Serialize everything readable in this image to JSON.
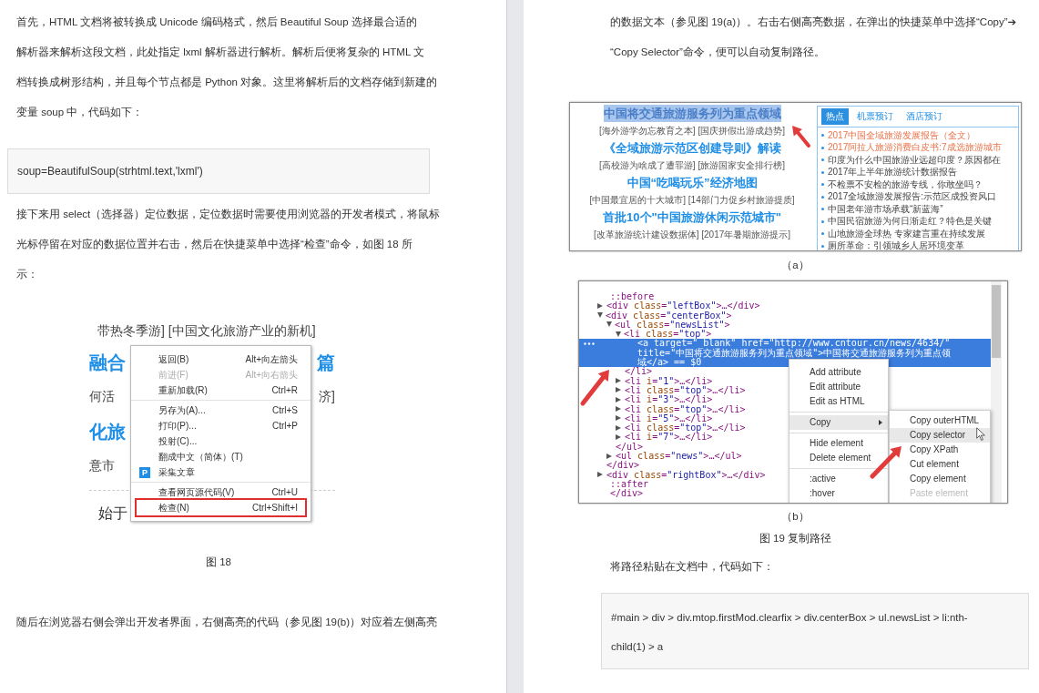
{
  "left_page": {
    "paragraph_1": [
      "首先，HTML 文档将被转换成 Unicode 编码格式，然后 Beautiful Soup 选择最合适的",
      "解析器来解析这段文档，此处指定 lxml 解析器进行解析。解析后便将复杂的 HTML 文",
      "档转换成树形结构，并且每个节点都是 Python 对象。这里将解析后的文档存储到新建的",
      "变量 soup 中，代码如下："
    ],
    "code": [
      "soup=BeautifulSoup(strhtml.text,'lxml')"
    ],
    "paragraph_2": [
      "接下来用 select（选择器）定位数据，定位数据时需要使用浏览器的开发者模式，将鼠标",
      "光标停留在对应的数据位置并右击，然后在快捷菜单中选择“检查”命令，如图 18 所",
      "示："
    ],
    "figure_18": {
      "background_rows": [
        {
          "kind": "line",
          "left": "带热冬季游] [中国文化旅游产业的新机]",
          "right": ""
        },
        {
          "kind": "headline",
          "left": "融合",
          "right": "篇"
        },
        {
          "kind": "line",
          "left": "何活",
          "right": "济]"
        },
        {
          "kind": "headline",
          "left": "化旅",
          "right": ""
        },
        {
          "kind": "line",
          "left": "意市",
          "right": ""
        },
        {
          "kind": "rule",
          "left": "",
          "right": ""
        },
        {
          "kind": "lead",
          "left": "始于",
          "right": ""
        }
      ],
      "menu": [
        [
          {
            "label": "返回(B)",
            "shortcut": "Alt+向左箭头",
            "disabled": false,
            "highlighted": false
          },
          {
            "label": "前进(F)",
            "shortcut": "Alt+向右箭头",
            "disabled": true,
            "highlighted": false
          },
          {
            "label": "重新加载(R)",
            "shortcut": "Ctrl+R",
            "disabled": false,
            "highlighted": false
          }
        ],
        [
          {
            "label": "另存为(A)...",
            "shortcut": "Ctrl+S",
            "disabled": false,
            "highlighted": false
          },
          {
            "label": "打印(P)...",
            "shortcut": "Ctrl+P",
            "disabled": false,
            "highlighted": false
          },
          {
            "label": "投射(C)...",
            "disabled": false,
            "highlighted": false
          },
          {
            "label": "翻成中文（简体）(T)",
            "disabled": false,
            "highlighted": false
          },
          {
            "label": "采集文章",
            "badge": "P",
            "disabled": false,
            "highlighted": false
          }
        ],
        [
          {
            "label": "查看网页源代码(V)",
            "shortcut": "Ctrl+U",
            "disabled": false,
            "highlighted": false
          },
          {
            "label": "检查(N)",
            "shortcut": "Ctrl+Shift+I",
            "disabled": false,
            "highlighted": true
          }
        ]
      ]
    },
    "caption": "图 18",
    "paragraph_3": [
      "随后在浏览器右侧会弹出开发者界面，右侧高亮的代码（参见图 19(b)）对应着左侧高亮"
    ]
  },
  "right_page": {
    "paragraph_1": [
      "的数据文本（参见图 19(a)）。右击右侧高亮数据，在弹出的快捷菜单中选择“Copy”➔",
      "“Copy Selector”命令，便可以自动复制路径。"
    ],
    "figure_a": {
      "headlines": [
        {
          "title": "中国将交通旅游服务列为重点领域",
          "selected": true,
          "links": "[海外游学勿忘教育之本] [国庆拼假出游成趋势]"
        },
        {
          "title": "《全域旅游示范区创建导则》解读",
          "selected": false,
          "links": "[高校游为啥成了遭罪游] [旅游国家安全排行榜]"
        },
        {
          "title": "中国“吃喝玩乐”经济地图",
          "selected": false,
          "links": "[中国最宜居的十大城市] [14部门力促乡村旅游提质]"
        },
        {
          "title": "首批10个\"中国旅游休闲示范城市\"",
          "selected": false,
          "links": "[改革旅游统计建设数据体] [2017年暑期旅游提示]"
        }
      ],
      "tabs": [
        {
          "label": "热点",
          "selected": true
        },
        {
          "label": "机票预订",
          "selected": false
        },
        {
          "label": "酒店预订",
          "selected": false
        }
      ],
      "news": [
        {
          "text": "2017中国全域旅游发展报告（全文）",
          "highlighted": true
        },
        {
          "text": "2017阿拉人旅游消费白皮书:7成选旅游城市",
          "highlighted": true
        },
        {
          "text": "印度为什么中国旅游业远超印度？原因都在",
          "highlighted": false
        },
        {
          "text": "2017年上半年旅游统计数据报告",
          "highlighted": false
        },
        {
          "text": "不检票不安检的旅游专线，你敢坐吗？",
          "highlighted": false
        },
        {
          "text": "2017全域旅游发展报告:示范区成投资风口",
          "highlighted": false
        },
        {
          "text": "中国老年游市场承载“新蓝海”",
          "highlighted": false
        },
        {
          "text": "中国民宿旅游为何日渐走红？特色是关键",
          "highlighted": false
        },
        {
          "text": "山地旅游全球热 专家建言重在持续发展",
          "highlighted": false
        },
        {
          "text": "厕所革命：引领城乡人居环境变革",
          "highlighted": false
        }
      ]
    },
    "caption_a": "（a）",
    "figure_b": {
      "dom_tree": [
        {
          "kind": "pseudo",
          "text": "::before",
          "selected": false
        },
        {
          "kind": "element",
          "text": "<div class=\"leftBox\">…</div>",
          "expanded": false,
          "selected": false
        },
        {
          "kind": "element",
          "text": "<div class=\"centerBox\">",
          "expanded": true,
          "selected": false,
          "end": "</div>",
          "children": [
            {
              "kind": "element",
              "text": "<ul class=\"newsList\">",
              "expanded": true,
              "selected": false,
              "end": "</ul>",
              "children": [
                {
                  "kind": "element",
                  "text": "<li class=\"top\">",
                  "expanded": true,
                  "selected": false,
                  "end": "</li>",
                  "children": [
                    {
                      "kind": "leaf",
                      "text": "<a target=\"_blank\" href=\"http://www.cntour.cn/news/4634/\" title=\"中国将交通旅游服务列为重点领域\">中国将交通旅游服务列为重点领域</a> == $0",
                      "selected": true
                    }
                  ]
                },
                {
                  "kind": "element",
                  "text": "<li i=\"1\">…</li>",
                  "expanded": false,
                  "selected": false
                },
                {
                  "kind": "element",
                  "text": "<li class=\"top\">…</li>",
                  "expanded": false,
                  "selected": false
                },
                {
                  "kind": "element",
                  "text": "<li i=\"3\">…</li>",
                  "expanded": false,
                  "selected": false
                },
                {
                  "kind": "element",
                  "text": "<li class=\"top\">…</li>",
                  "expanded": false,
                  "selected": false
                },
                {
                  "kind": "element",
                  "text": "<li i=\"5\">…</li>",
                  "expanded": false,
                  "selected": false
                },
                {
                  "kind": "element",
                  "text": "<li class=\"top\">…</li>",
                  "expanded": false,
                  "selected": false
                },
                {
                  "kind": "element",
                  "text": "<li i=\"7\">…</li>",
                  "expanded": false,
                  "selected": false
                }
              ]
            },
            {
              "kind": "element",
              "text": "<ul class=\"news\">…</ul>",
              "expanded": false,
              "selected": false
            }
          ]
        },
        {
          "kind": "element",
          "text": "<div class=\"rightBox\">…</div>",
          "expanded": false,
          "selected": false
        },
        {
          "kind": "pseudo",
          "text": "::after",
          "selected": false
        },
        {
          "kind": "pseudo",
          "text": "</div>",
          "selected": false
        }
      ],
      "menu": [
        [
          {
            "label": "Add attribute",
            "hovered": false,
            "disabled": false,
            "submenu": false
          },
          {
            "label": "Edit attribute",
            "hovered": false,
            "disabled": false,
            "submenu": false
          },
          {
            "label": "Edit as HTML",
            "hovered": false,
            "disabled": false,
            "submenu": false
          }
        ],
        [
          {
            "label": "Copy",
            "hovered": true,
            "disabled": false,
            "submenu": true
          }
        ],
        [
          {
            "label": "Hide element",
            "hovered": false,
            "disabled": false,
            "submenu": false
          },
          {
            "label": "Delete element",
            "hovered": false,
            "disabled": false,
            "submenu": false
          }
        ],
        [
          {
            "label": ":active",
            "hovered": false,
            "disabled": false,
            "submenu": false
          },
          {
            "label": ":hover",
            "hovered": false,
            "disabled": false,
            "submenu": false
          }
        ]
      ],
      "submenu": [
        {
          "label": "Copy outerHTML",
          "hovered": false,
          "disabled": false
        },
        {
          "label": "Copy selector",
          "hovered": true,
          "disabled": false
        },
        {
          "label": "Copy XPath",
          "hovered": false,
          "disabled": false
        },
        {
          "label": "Cut element",
          "hovered": false,
          "disabled": false
        },
        {
          "label": "Copy element",
          "hovered": false,
          "disabled": false
        },
        {
          "label": "Paste element",
          "hovered": false,
          "disabled": true
        }
      ]
    },
    "caption_b": "（b）",
    "caption": "图 19 复制路径",
    "paragraph_2": [
      "将路径粘贴在文档中，代码如下："
    ],
    "code": [
      "#main > div > div.mtop.firstMod.clearfix > div.centerBox > ul.newsList > li:nth-",
      "child(1) > a"
    ]
  }
}
